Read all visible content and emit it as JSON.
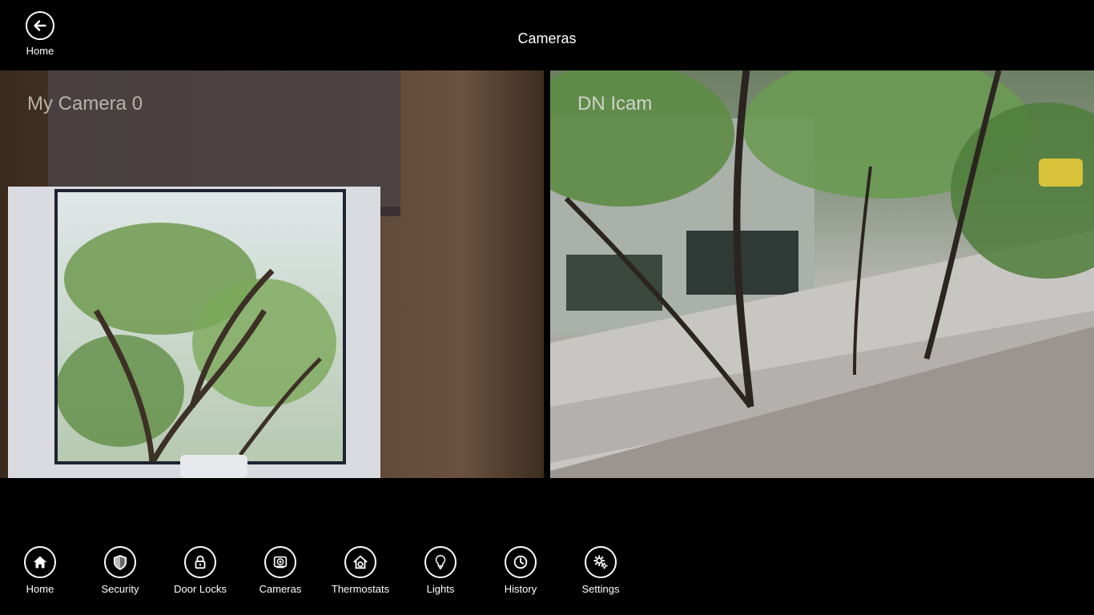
{
  "header": {
    "back_label": "Home",
    "title": "Cameras"
  },
  "cameras": [
    {
      "name": "My Camera 0"
    },
    {
      "name": "DN Icam"
    }
  ],
  "nav": {
    "items": [
      {
        "label": "Home",
        "icon": "house-icon"
      },
      {
        "label": "Security",
        "icon": "shield-icon"
      },
      {
        "label": "Door Locks",
        "icon": "lock-icon"
      },
      {
        "label": "Cameras",
        "icon": "camera-icon"
      },
      {
        "label": "Thermostats",
        "icon": "thermostat-home-icon"
      },
      {
        "label": "Lights",
        "icon": "lightbulb-icon"
      },
      {
        "label": "History",
        "icon": "clock-icon"
      },
      {
        "label": "Settings",
        "icon": "gears-icon"
      }
    ]
  }
}
